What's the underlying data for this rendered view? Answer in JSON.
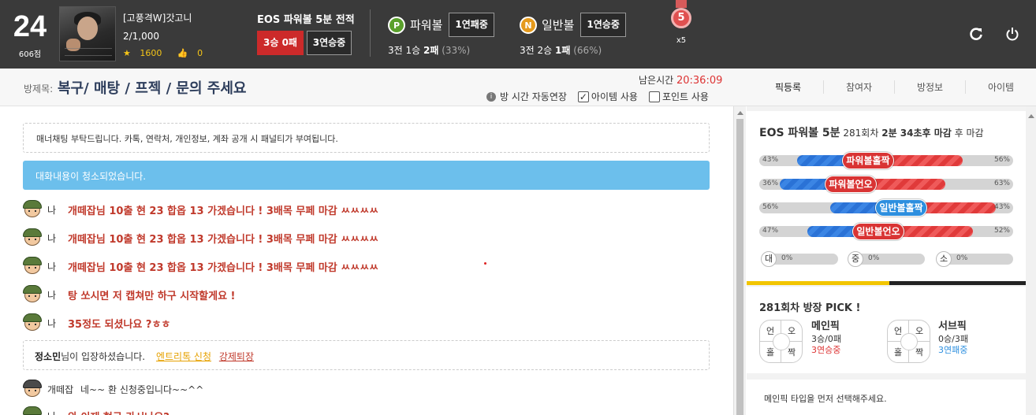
{
  "user": {
    "level": "24",
    "points": "606점",
    "name": "[고풍격W]갓고니",
    "count": "2/1,000",
    "coins": "1600",
    "likes": "0"
  },
  "eos": {
    "title": "EOS 파워볼 5분 전적",
    "record": "3승 0패",
    "streak": "3연승중"
  },
  "powerball": {
    "badge": "P",
    "name": "파워볼",
    "streak": "1연패중",
    "rec_a": "3전 1승 ",
    "rec_b": "2패",
    "rec_pct": " (33%)"
  },
  "normalball": {
    "badge": "N",
    "name": "일반볼",
    "streak": "1연승중",
    "rec_a": "3전 2승 ",
    "rec_b": "1패",
    "rec_pct": " (66%)"
  },
  "medal": {
    "num": "5",
    "mult": "x5"
  },
  "room": {
    "label": "방제목:",
    "title": "복구/ 매탕 / 프젝 / 문의 주세요",
    "remain_label": "남은시간 ",
    "remain_time": "20:36:09",
    "auto_extend": "방 시간 자동연장",
    "item_use": "아이템 사용",
    "point_use": "포인트 사용"
  },
  "tabs": [
    "픽등록",
    "참여자",
    "방정보",
    "아이템"
  ],
  "chat": {
    "notice": "매너채팅 부탁드립니다. 카톡, 연락처, 개인정보, 계좌 공개 시 패널티가 부여됩니다.",
    "cleared": "대화내용이 청소되었습니다.",
    "messages": [
      {
        "who": "나",
        "text": "개떼잡님 10출 현 23 합옵 13 가겠습니다 ! 3배목 무페 마감 ㅆㅆㅆㅆ"
      },
      {
        "who": "나",
        "text": "개떼잡님 10출 현 23 합옵 13 가겠습니다 ! 3배목 무페 마감 ㅆㅆㅆㅆ"
      },
      {
        "who": "나",
        "text": "개떼잡님 10출 현 23 합옵 13 가겠습니다 ! 3배목 무페 마감 ㅆㅆㅆㅆ"
      },
      {
        "who": "나",
        "text": "탕 쏘시면 저 캡쳐만 하구 시작할게요 !"
      },
      {
        "who": "나",
        "text": "35정도 되셨나요 ?ㅎㅎ"
      }
    ],
    "enter_name": "정소민",
    "enter_text": "님이 입장하셨습니다.",
    "enter_link1": "엔트리톡 신청",
    "enter_link2": "강제퇴장",
    "last_who": "개떼잡",
    "last_text": "네~~ 환 신청중입니다~~^^",
    "partial_who": "나",
    "partial_text": "와 이제 현금 가시나요?"
  },
  "panel": {
    "title": "EOS 파워볼 5분",
    "round": "281회차",
    "deadline": "2분 34초후 마감",
    "post": "후 마감",
    "bars": [
      {
        "label": "파워볼홀짝",
        "left": "43%",
        "right": "56%",
        "pill": "red"
      },
      {
        "label": "파워볼언오",
        "left": "36%",
        "right": "63%",
        "pill": "red"
      },
      {
        "label": "일반볼홀짝",
        "left": "56%",
        "right": "43%",
        "pill": "blue"
      },
      {
        "label": "일반볼언오",
        "left": "47%",
        "right": "52%",
        "pill": "red"
      }
    ],
    "bar_left_frac": [
      0.43,
      0.36,
      0.56,
      0.47
    ],
    "mini": [
      {
        "label": "대",
        "val": "0%"
      },
      {
        "label": "중",
        "val": "0%"
      },
      {
        "label": "소",
        "val": "0%"
      }
    ],
    "pick_title": "281회차 방장 PICK !",
    "pick_quads": [
      "언",
      "오",
      "홀",
      "짝"
    ],
    "main_name": "메인픽",
    "main_rec": "3승/0패",
    "main_streak": "3연승중",
    "sub_name": "서브픽",
    "sub_rec": "0승/3패",
    "sub_streak": "3연패중",
    "select_msg": "메인픽 타입을 먼저 선택해주세요."
  }
}
